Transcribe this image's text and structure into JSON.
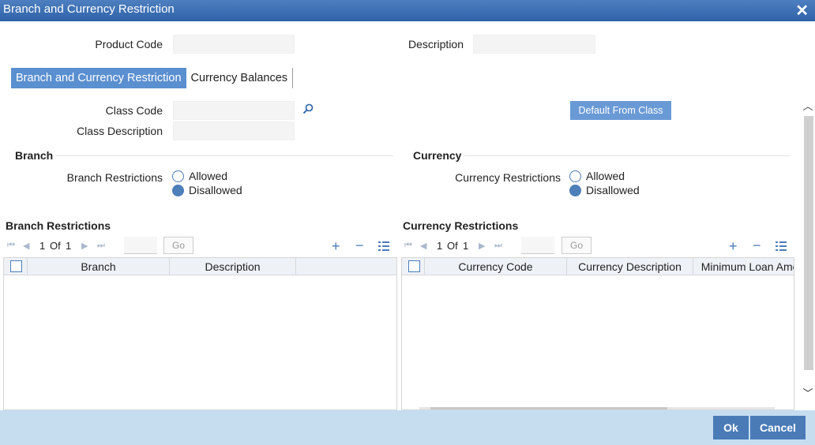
{
  "window": {
    "title": "Branch and Currency Restriction",
    "close_glyph": "✕"
  },
  "header": {
    "product_code_label": "Product Code",
    "product_code_value": "",
    "description_label": "Description",
    "description_value": ""
  },
  "tabs": [
    {
      "label": "Branch and Currency Restriction",
      "active": true
    },
    {
      "label": "Currency Balances",
      "active": false
    }
  ],
  "class_section": {
    "class_code_label": "Class Code",
    "class_code_value": "",
    "class_description_label": "Class Description",
    "class_description_value": "",
    "default_button": "Default From Class",
    "lookup_icon": "search-icon"
  },
  "branch": {
    "section_title": "Branch",
    "restrictions_label": "Branch Restrictions",
    "options": [
      "Allowed",
      "Disallowed"
    ],
    "selected": "Disallowed"
  },
  "currency": {
    "section_title": "Currency",
    "restrictions_label": "Currency Restrictions",
    "options": [
      "Allowed",
      "Disallowed"
    ],
    "selected": "Disallowed"
  },
  "branch_grid": {
    "title": "Branch Restrictions",
    "page": "1",
    "of_label": "Of",
    "total_pages": "1",
    "go_label": "Go",
    "columns": [
      "Branch",
      "Description"
    ]
  },
  "currency_grid": {
    "title": "Currency Restrictions",
    "page": "1",
    "of_label": "Of",
    "total_pages": "1",
    "go_label": "Go",
    "columns": [
      "Currency Code",
      "Currency Description",
      "Minimum Loan Amou"
    ]
  },
  "footer": {
    "ok_label": "Ok",
    "cancel_label": "Cancel"
  },
  "colors": {
    "title_bar": "#3a6db2",
    "accent": "#5a8fd0",
    "footer_bg": "#c6ddf0",
    "button": "#4a7bb7"
  }
}
